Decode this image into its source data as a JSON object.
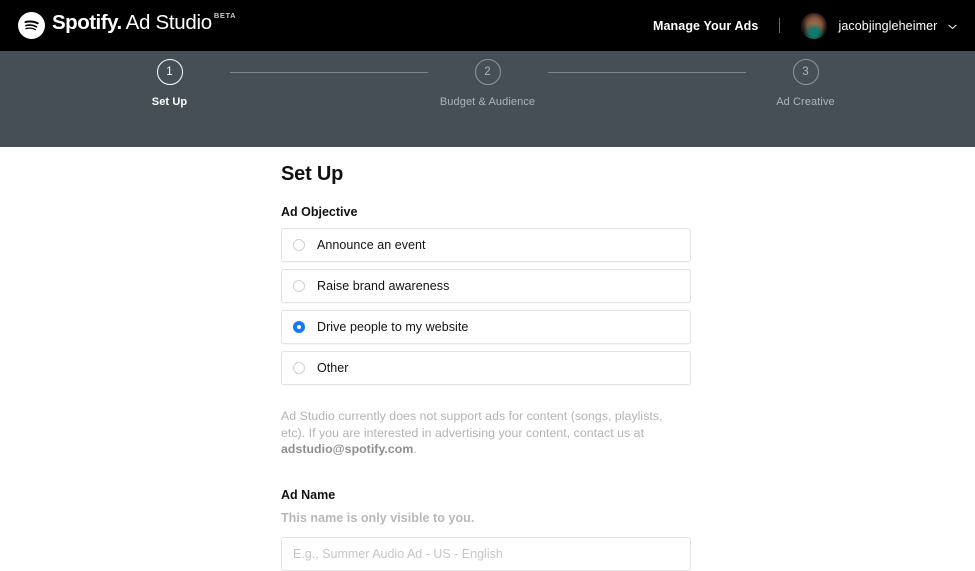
{
  "header": {
    "brand_word_1": "Spotify.",
    "brand_word_2": "Ad Studio",
    "beta_badge": "BETA",
    "manage_ads_label": "Manage Your Ads",
    "username": "jacobjingleheimer",
    "chevron_glyph": "⌄",
    "background_color": "#000000"
  },
  "stepper": {
    "background_color": "#454F55",
    "steps": [
      {
        "number": "1",
        "label": "Set Up",
        "active": true
      },
      {
        "number": "2",
        "label": "Budget & Audience",
        "active": false
      },
      {
        "number": "3",
        "label": "Ad Creative",
        "active": false
      }
    ]
  },
  "main": {
    "page_title": "Set Up",
    "ad_objective": {
      "label": "Ad Objective",
      "options": [
        {
          "label": "Announce an event",
          "selected": false
        },
        {
          "label": "Raise brand awareness",
          "selected": false
        },
        {
          "label": "Drive people to my website",
          "selected": true
        },
        {
          "label": "Other",
          "selected": false
        }
      ],
      "selected_color": "#1779f4",
      "helper_text_part_1": "Ad Studio currently does not support ads for content (songs, playlists, etc). If you are interested in advertising your content, contact us at ",
      "helper_text_email": "adstudio@spotify.com",
      "helper_text_part_2": "."
    },
    "ad_name": {
      "label": "Ad Name",
      "sub_note": "This name is only visible to you.",
      "input_value": "",
      "input_placeholder": "E.g., Summer Audio Ad - US - English"
    }
  }
}
